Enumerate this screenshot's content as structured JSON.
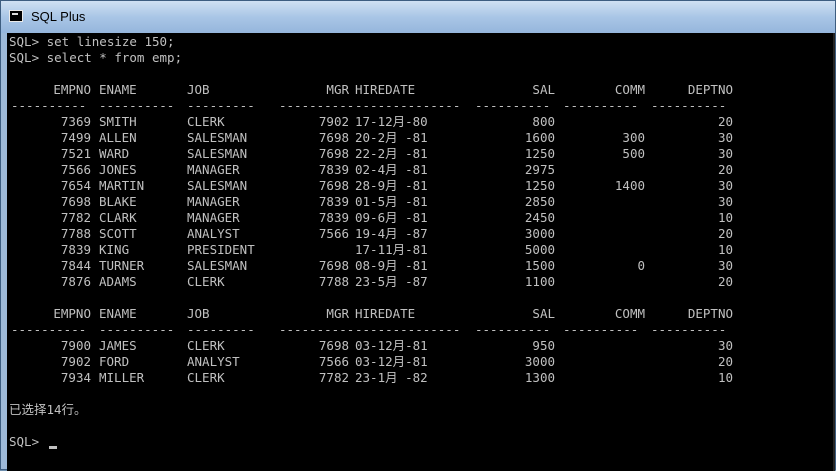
{
  "window": {
    "title": "SQL Plus",
    "icon": "console-icon"
  },
  "commands": [
    "SQL> set linesize 150;",
    "SQL> select * from emp;"
  ],
  "columns": [
    "EMPNO",
    "ENAME",
    "JOB",
    "MGR",
    "HIREDATE",
    "SAL",
    "COMM",
    "DEPTNO"
  ],
  "separators": [
    "----------",
    "----------",
    "---------",
    "----------",
    "--------------",
    "----------",
    "----------",
    "----------"
  ],
  "page1_rows": [
    [
      "7369",
      "SMITH",
      "CLERK",
      "7902",
      "17-12月-80",
      "800",
      "",
      "20"
    ],
    [
      "7499",
      "ALLEN",
      "SALESMAN",
      "7698",
      "20-2月 -81",
      "1600",
      "300",
      "30"
    ],
    [
      "7521",
      "WARD",
      "SALESMAN",
      "7698",
      "22-2月 -81",
      "1250",
      "500",
      "30"
    ],
    [
      "7566",
      "JONES",
      "MANAGER",
      "7839",
      "02-4月 -81",
      "2975",
      "",
      "20"
    ],
    [
      "7654",
      "MARTIN",
      "SALESMAN",
      "7698",
      "28-9月 -81",
      "1250",
      "1400",
      "30"
    ],
    [
      "7698",
      "BLAKE",
      "MANAGER",
      "7839",
      "01-5月 -81",
      "2850",
      "",
      "30"
    ],
    [
      "7782",
      "CLARK",
      "MANAGER",
      "7839",
      "09-6月 -81",
      "2450",
      "",
      "10"
    ],
    [
      "7788",
      "SCOTT",
      "ANALYST",
      "7566",
      "19-4月 -87",
      "3000",
      "",
      "20"
    ],
    [
      "7839",
      "KING",
      "PRESIDENT",
      "",
      "17-11月-81",
      "5000",
      "",
      "10"
    ],
    [
      "7844",
      "TURNER",
      "SALESMAN",
      "7698",
      "08-9月 -81",
      "1500",
      "0",
      "30"
    ],
    [
      "7876",
      "ADAMS",
      "CLERK",
      "7788",
      "23-5月 -87",
      "1100",
      "",
      "20"
    ]
  ],
  "page2_rows": [
    [
      "7900",
      "JAMES",
      "CLERK",
      "7698",
      "03-12月-81",
      "950",
      "",
      "30"
    ],
    [
      "7902",
      "FORD",
      "ANALYST",
      "7566",
      "03-12月-81",
      "3000",
      "",
      "20"
    ],
    [
      "7934",
      "MILLER",
      "CLERK",
      "7782",
      "23-1月 -82",
      "1300",
      "",
      "10"
    ]
  ],
  "result_message": "已选择14行。",
  "prompt": "SQL>"
}
